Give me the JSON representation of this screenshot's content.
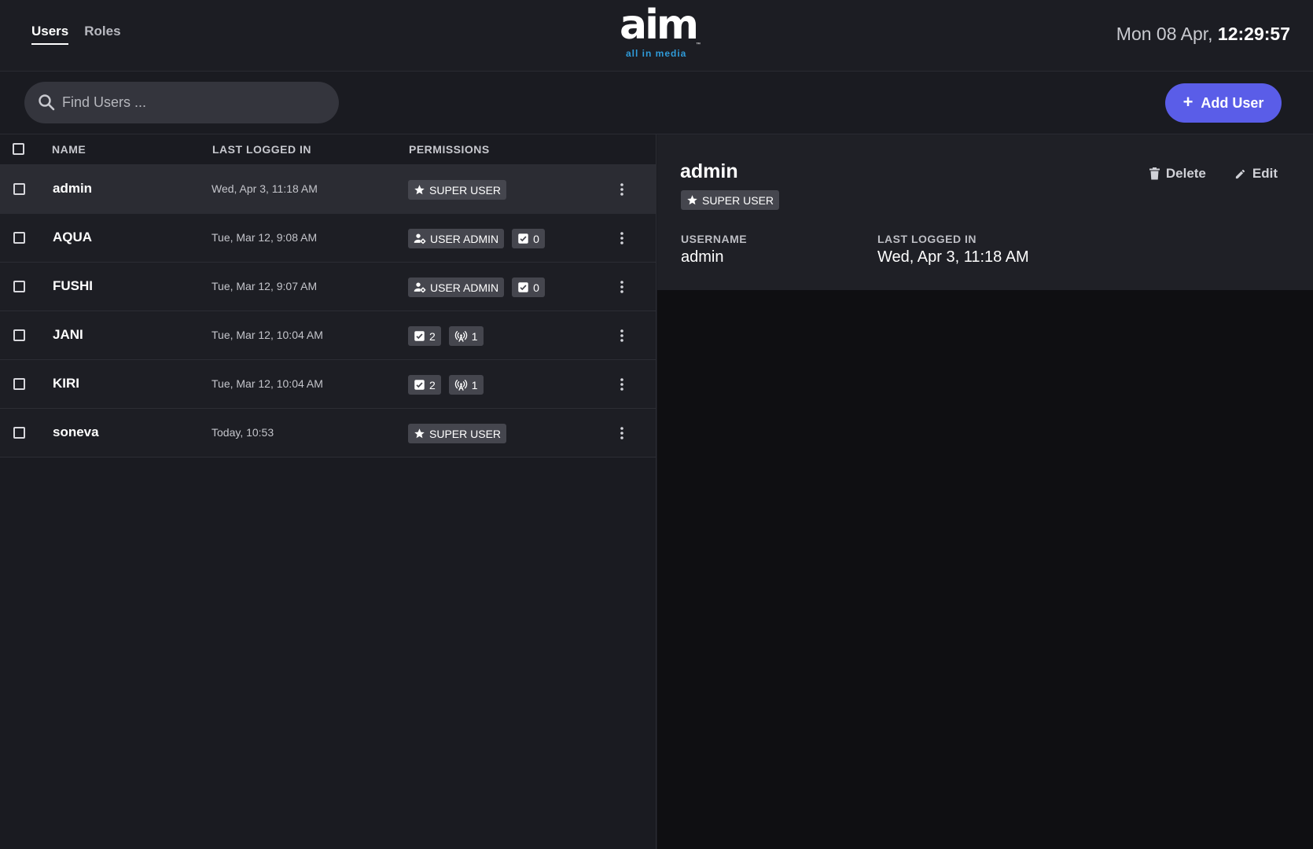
{
  "nav": {
    "tabs": [
      {
        "label": "Users",
        "active": true
      },
      {
        "label": "Roles",
        "active": false
      }
    ]
  },
  "logo": {
    "word": "aim",
    "tagline": "all in media",
    "tm": "™"
  },
  "clock": {
    "date": "Mon 08 Apr,",
    "time": "12:29:57"
  },
  "search": {
    "placeholder": "Find Users ...",
    "value": ""
  },
  "add_user": {
    "label": "Add User"
  },
  "table": {
    "headers": {
      "name": "NAME",
      "last": "LAST LOGGED IN",
      "permissions": "PERMISSIONS"
    },
    "rows": [
      {
        "name": "admin",
        "last": "Wed, Apr 3, 11:18 AM",
        "badges": [
          {
            "icon": "star-icon",
            "label": "SUPER USER"
          }
        ],
        "selected": true
      },
      {
        "name": "AQUA",
        "last": "Tue, Mar 12, 9:08 AM",
        "badges": [
          {
            "icon": "user-admin-icon",
            "label": "USER ADMIN"
          },
          {
            "icon": "checkbox-icon",
            "label": "0"
          }
        ],
        "selected": false
      },
      {
        "name": "FUSHI",
        "last": "Tue, Mar 12, 9:07 AM",
        "badges": [
          {
            "icon": "user-admin-icon",
            "label": "USER ADMIN"
          },
          {
            "icon": "checkbox-icon",
            "label": "0"
          }
        ],
        "selected": false
      },
      {
        "name": "JANI",
        "last": "Tue, Mar 12, 10:04 AM",
        "badges": [
          {
            "icon": "checkbox-icon",
            "label": "2"
          },
          {
            "icon": "broadcast-icon",
            "label": "1"
          }
        ],
        "selected": false
      },
      {
        "name": "KIRI",
        "last": "Tue, Mar 12, 10:04 AM",
        "badges": [
          {
            "icon": "checkbox-icon",
            "label": "2"
          },
          {
            "icon": "broadcast-icon",
            "label": "1"
          }
        ],
        "selected": false
      },
      {
        "name": "soneva",
        "last": "Today, 10:53",
        "badges": [
          {
            "icon": "star-icon",
            "label": "SUPER USER"
          }
        ],
        "selected": false
      }
    ]
  },
  "detail": {
    "title": "admin",
    "badge": "SUPER USER",
    "delete_label": "Delete",
    "edit_label": "Edit",
    "username_label": "USERNAME",
    "username_value": "admin",
    "last_label": "LAST LOGGED IN",
    "last_value": "Wed, Apr 3, 11:18 AM"
  },
  "colors": {
    "accent": "#5a5de8",
    "logo_tagline": "#2f9bd9",
    "background": "#1a1b21",
    "badge": "#45464e"
  }
}
